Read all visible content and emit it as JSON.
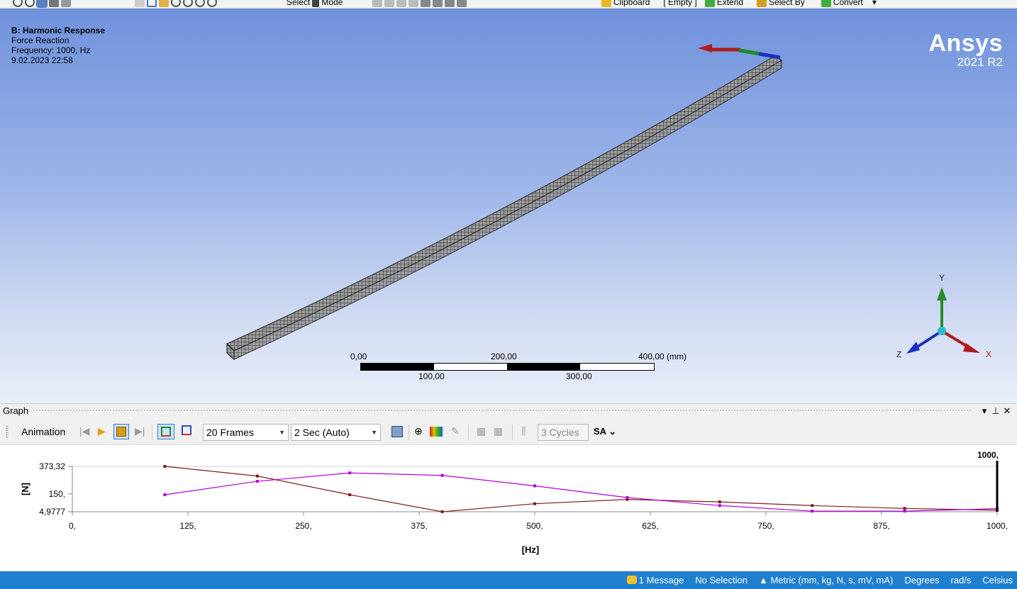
{
  "toolbar": {
    "select_label": "Select",
    "mode_label": "Mode",
    "clipboard_label": "Clipboard",
    "empty_label": "[ Empty ]",
    "extend_label": "Extend",
    "select_by_label": "Select By",
    "convert_label": "Convert"
  },
  "viewport": {
    "title": "B: Harmonic Response",
    "subtitle": "Force Reaction",
    "frequency": "Frequency: 1000, Hz",
    "date": "9.02.2023 22:58",
    "brand": "Ansys",
    "version": "2021 R2",
    "scale": {
      "l0": "0,00",
      "l200": "200,00",
      "l400": "400,00 (mm)",
      "l100": "100,00",
      "l300": "300,00"
    },
    "triad": {
      "x": "X",
      "y": "Y",
      "z": "Z"
    }
  },
  "graph": {
    "title": "Graph",
    "animation_label": "Animation",
    "frames_value": "20 Frames",
    "duration_value": "2 Sec (Auto)",
    "cycles_value": "3 Cycles",
    "sa_label": "SA"
  },
  "chart_data": {
    "type": "line",
    "xlabel": "[Hz]",
    "ylabel": "[N]",
    "xlim": [
      0,
      1000
    ],
    "ylim": [
      4.9777,
      373.32
    ],
    "x_ticks": [
      "0,",
      "125,",
      "250,",
      "375,",
      "500,",
      "625,",
      "750,",
      "875,",
      "1000,"
    ],
    "y_ticks": [
      "373,32",
      "150,",
      "4,9777"
    ],
    "marker_label": "1000,",
    "x": [
      100,
      200,
      300,
      400,
      500,
      600,
      700,
      800,
      900,
      1000
    ],
    "series": [
      {
        "color": "#7a1f1f",
        "values": [
          373.32,
          295,
          143,
          4.98,
          70,
          105,
          85,
          55,
          32,
          18
        ]
      },
      {
        "color": "#b400d8",
        "values": [
          143,
          252,
          320,
          300,
          215,
          120,
          55,
          10,
          10,
          30
        ]
      }
    ]
  },
  "statusbar": {
    "messages": "1 Message",
    "selection": "No Selection",
    "units": "▲ Metric (mm, kg, N, s, mV, mA)",
    "angle": "Degrees",
    "angular_velocity": "rad/s",
    "temperature": "Celsius"
  }
}
